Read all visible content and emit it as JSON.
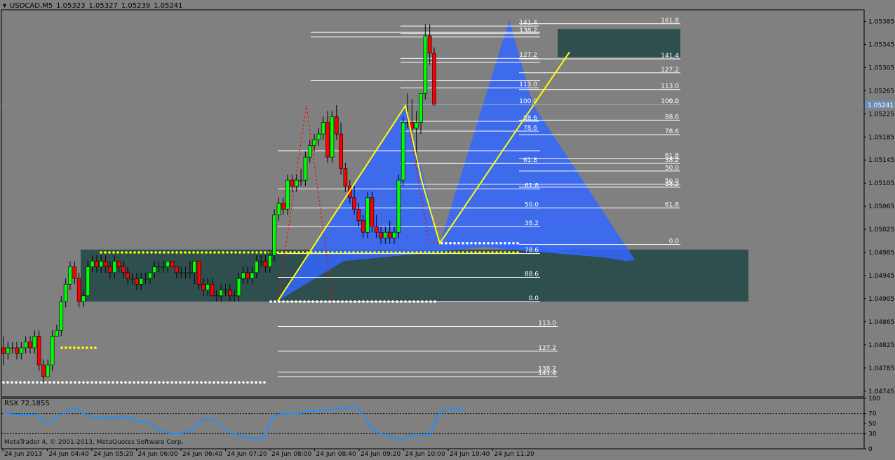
{
  "header": {
    "symbol": "USDCAD,M5",
    "open": "1.05323",
    "high": "1.05327",
    "low": "1.05239",
    "close": "1.05241"
  },
  "indicator": {
    "name": "RSX 72.1855",
    "levels": [
      "100",
      "70",
      "50",
      "30",
      "0"
    ]
  },
  "copyright": "MetaTrader 4, © 2001-2013, MetaQuotes Software Corp.",
  "colors": {
    "background": "#808080",
    "bull": "#00ff00",
    "bear": "#ff0000",
    "pattern": "#3366ff",
    "zone": "#2f4f4f",
    "trendline": "#ffff00",
    "rsx": "#1e90ff"
  },
  "price_label": "1.05241",
  "chart_data": {
    "type": "candlestick",
    "title": "USDCAD,M5",
    "ylim": [
      1.04735,
      1.05405
    ],
    "y_ticks": [
      "1.05385",
      "1.05345",
      "1.05305",
      "1.05265",
      "1.05225",
      "1.05185",
      "1.05145",
      "1.05105",
      "1.05065",
      "1.05025",
      "1.04985",
      "1.04945",
      "1.04905",
      "1.04865",
      "1.04825",
      "1.04785",
      "1.04745"
    ],
    "x_labels": [
      "24 Jun 2013",
      "24 Jun 04:40",
      "24 Jun 05:20",
      "24 Jun 06:00",
      "24 Jun 06:40",
      "24 Jun 07:20",
      "24 Jun 08:00",
      "24 Jun 08:40",
      "24 Jun 09:20",
      "24 Jun 10:00",
      "24 Jun 10:40",
      "24 Jun 11:20"
    ],
    "candles": [
      {
        "o": 1.0482,
        "h": 1.0484,
        "l": 1.0479,
        "c": 1.0481
      },
      {
        "o": 1.0481,
        "h": 1.0483,
        "l": 1.048,
        "c": 1.0482
      },
      {
        "o": 1.0482,
        "h": 1.0483,
        "l": 1.0481,
        "c": 1.0482
      },
      {
        "o": 1.0482,
        "h": 1.0483,
        "l": 1.048,
        "c": 1.0481
      },
      {
        "o": 1.0481,
        "h": 1.0483,
        "l": 1.048,
        "c": 1.0482
      },
      {
        "o": 1.0482,
        "h": 1.0484,
        "l": 1.0481,
        "c": 1.0483
      },
      {
        "o": 1.0483,
        "h": 1.0484,
        "l": 1.0481,
        "c": 1.0482
      },
      {
        "o": 1.0482,
        "h": 1.0485,
        "l": 1.0481,
        "c": 1.0484
      },
      {
        "o": 1.0484,
        "h": 1.0485,
        "l": 1.0478,
        "c": 1.0479
      },
      {
        "o": 1.0479,
        "h": 1.048,
        "l": 1.0476,
        "c": 1.0477
      },
      {
        "o": 1.0477,
        "h": 1.048,
        "l": 1.0477,
        "c": 1.0479
      },
      {
        "o": 1.0479,
        "h": 1.0485,
        "l": 1.0478,
        "c": 1.0484
      },
      {
        "o": 1.0484,
        "h": 1.0486,
        "l": 1.0484,
        "c": 1.0485
      },
      {
        "o": 1.0485,
        "h": 1.0491,
        "l": 1.0484,
        "c": 1.049
      },
      {
        "o": 1.049,
        "h": 1.0494,
        "l": 1.0489,
        "c": 1.0493
      },
      {
        "o": 1.0493,
        "h": 1.0497,
        "l": 1.0492,
        "c": 1.0496
      },
      {
        "o": 1.0496,
        "h": 1.0497,
        "l": 1.0493,
        "c": 1.0494
      },
      {
        "o": 1.0494,
        "h": 1.0495,
        "l": 1.0489,
        "c": 1.049
      },
      {
        "o": 1.049,
        "h": 1.0492,
        "l": 1.0489,
        "c": 1.0491
      },
      {
        "o": 1.0491,
        "h": 1.0497,
        "l": 1.0491,
        "c": 1.0496
      },
      {
        "o": 1.0496,
        "h": 1.0498,
        "l": 1.0495,
        "c": 1.0497
      },
      {
        "o": 1.0497,
        "h": 1.0498,
        "l": 1.0495,
        "c": 1.0496
      },
      {
        "o": 1.0496,
        "h": 1.0498,
        "l": 1.0495,
        "c": 1.0497
      },
      {
        "o": 1.0497,
        "h": 1.0498,
        "l": 1.0495,
        "c": 1.0496
      },
      {
        "o": 1.0496,
        "h": 1.0497,
        "l": 1.0494,
        "c": 1.0495
      },
      {
        "o": 1.0495,
        "h": 1.0498,
        "l": 1.0494,
        "c": 1.0497
      },
      {
        "o": 1.0497,
        "h": 1.0497,
        "l": 1.0495,
        "c": 1.0496
      },
      {
        "o": 1.0496,
        "h": 1.0497,
        "l": 1.0494,
        "c": 1.0495
      },
      {
        "o": 1.0495,
        "h": 1.0496,
        "l": 1.0493,
        "c": 1.0494
      },
      {
        "o": 1.0494,
        "h": 1.0495,
        "l": 1.0493,
        "c": 1.0494
      },
      {
        "o": 1.0494,
        "h": 1.0495,
        "l": 1.0492,
        "c": 1.0493
      },
      {
        "o": 1.0493,
        "h": 1.0495,
        "l": 1.0492,
        "c": 1.0494
      },
      {
        "o": 1.0494,
        "h": 1.0495,
        "l": 1.0493,
        "c": 1.0494
      },
      {
        "o": 1.0494,
        "h": 1.0495,
        "l": 1.0493,
        "c": 1.0495
      },
      {
        "o": 1.0495,
        "h": 1.0497,
        "l": 1.0494,
        "c": 1.0496
      },
      {
        "o": 1.0496,
        "h": 1.0497,
        "l": 1.0495,
        "c": 1.0496
      },
      {
        "o": 1.0496,
        "h": 1.0497,
        "l": 1.0495,
        "c": 1.0496
      },
      {
        "o": 1.0496,
        "h": 1.0497,
        "l": 1.0495,
        "c": 1.0497
      },
      {
        "o": 1.0497,
        "h": 1.0497,
        "l": 1.0496,
        "c": 1.0496
      },
      {
        "o": 1.0496,
        "h": 1.0496,
        "l": 1.0494,
        "c": 1.0495
      },
      {
        "o": 1.0495,
        "h": 1.0496,
        "l": 1.0494,
        "c": 1.0495
      },
      {
        "o": 1.0495,
        "h": 1.0496,
        "l": 1.0494,
        "c": 1.0495
      },
      {
        "o": 1.0495,
        "h": 1.0497,
        "l": 1.0494,
        "c": 1.0495
      },
      {
        "o": 1.0495,
        "h": 1.0497,
        "l": 1.0493,
        "c": 1.0497
      },
      {
        "o": 1.0497,
        "h": 1.0497,
        "l": 1.0492,
        "c": 1.0493
      },
      {
        "o": 1.0493,
        "h": 1.0494,
        "l": 1.0491,
        "c": 1.0492
      },
      {
        "o": 1.0492,
        "h": 1.0494,
        "l": 1.0491,
        "c": 1.0493
      },
      {
        "o": 1.0493,
        "h": 1.0494,
        "l": 1.0491,
        "c": 1.0491
      },
      {
        "o": 1.0491,
        "h": 1.0492,
        "l": 1.049,
        "c": 1.0491
      },
      {
        "o": 1.0491,
        "h": 1.0493,
        "l": 1.049,
        "c": 1.0492
      },
      {
        "o": 1.0492,
        "h": 1.0493,
        "l": 1.0491,
        "c": 1.0492
      },
      {
        "o": 1.0492,
        "h": 1.0493,
        "l": 1.049,
        "c": 1.0491
      },
      {
        "o": 1.0491,
        "h": 1.0492,
        "l": 1.049,
        "c": 1.0491
      },
      {
        "o": 1.0491,
        "h": 1.0495,
        "l": 1.049,
        "c": 1.0494
      },
      {
        "o": 1.0494,
        "h": 1.0496,
        "l": 1.0493,
        "c": 1.0495
      },
      {
        "o": 1.0495,
        "h": 1.0496,
        "l": 1.0493,
        "c": 1.0494
      },
      {
        "o": 1.0494,
        "h": 1.0496,
        "l": 1.0493,
        "c": 1.0495
      },
      {
        "o": 1.0495,
        "h": 1.0498,
        "l": 1.0494,
        "c": 1.0497
      },
      {
        "o": 1.0497,
        "h": 1.0498,
        "l": 1.0496,
        "c": 1.0497
      },
      {
        "o": 1.0497,
        "h": 1.0498,
        "l": 1.0495,
        "c": 1.0496
      },
      {
        "o": 1.0496,
        "h": 1.0499,
        "l": 1.0495,
        "c": 1.0498
      },
      {
        "o": 1.0498,
        "h": 1.0506,
        "l": 1.0497,
        "c": 1.0505
      },
      {
        "o": 1.0505,
        "h": 1.0508,
        "l": 1.0504,
        "c": 1.0507
      },
      {
        "o": 1.0507,
        "h": 1.0508,
        "l": 1.0505,
        "c": 1.0506
      },
      {
        "o": 1.0506,
        "h": 1.0512,
        "l": 1.0505,
        "c": 1.0511
      },
      {
        "o": 1.0511,
        "h": 1.0512,
        "l": 1.0509,
        "c": 1.051
      },
      {
        "o": 1.051,
        "h": 1.0512,
        "l": 1.0509,
        "c": 1.0511
      },
      {
        "o": 1.0511,
        "h": 1.0513,
        "l": 1.051,
        "c": 1.0511
      },
      {
        "o": 1.0511,
        "h": 1.0516,
        "l": 1.051,
        "c": 1.0515
      },
      {
        "o": 1.0515,
        "h": 1.0518,
        "l": 1.0514,
        "c": 1.0517
      },
      {
        "o": 1.0517,
        "h": 1.0519,
        "l": 1.0516,
        "c": 1.0518
      },
      {
        "o": 1.0518,
        "h": 1.052,
        "l": 1.0517,
        "c": 1.0519
      },
      {
        "o": 1.0519,
        "h": 1.0522,
        "l": 1.0518,
        "c": 1.0521
      },
      {
        "o": 1.0521,
        "h": 1.0523,
        "l": 1.0514,
        "c": 1.0515
      },
      {
        "o": 1.0515,
        "h": 1.0523,
        "l": 1.0514,
        "c": 1.0522
      },
      {
        "o": 1.0522,
        "h": 1.0524,
        "l": 1.0518,
        "c": 1.0519
      },
      {
        "o": 1.0519,
        "h": 1.0521,
        "l": 1.0512,
        "c": 1.0513
      },
      {
        "o": 1.0513,
        "h": 1.0514,
        "l": 1.0509,
        "c": 1.051
      },
      {
        "o": 1.051,
        "h": 1.0511,
        "l": 1.0507,
        "c": 1.0508
      },
      {
        "o": 1.0508,
        "h": 1.051,
        "l": 1.0505,
        "c": 1.0506
      },
      {
        "o": 1.0506,
        "h": 1.0507,
        "l": 1.0503,
        "c": 1.0504
      },
      {
        "o": 1.0504,
        "h": 1.0505,
        "l": 1.0501,
        "c": 1.0502
      },
      {
        "o": 1.0502,
        "h": 1.0509,
        "l": 1.0501,
        "c": 1.0508
      },
      {
        "o": 1.0508,
        "h": 1.0509,
        "l": 1.0502,
        "c": 1.0503
      },
      {
        "o": 1.0503,
        "h": 1.0505,
        "l": 1.0501,
        "c": 1.0502
      },
      {
        "o": 1.0502,
        "h": 1.0503,
        "l": 1.05,
        "c": 1.0501
      },
      {
        "o": 1.0501,
        "h": 1.0503,
        "l": 1.05,
        "c": 1.0502
      },
      {
        "o": 1.0502,
        "h": 1.0504,
        "l": 1.05,
        "c": 1.0501
      },
      {
        "o": 1.0501,
        "h": 1.0503,
        "l": 1.05,
        "c": 1.0502
      },
      {
        "o": 1.0502,
        "h": 1.0512,
        "l": 1.0501,
        "c": 1.0511
      },
      {
        "o": 1.0511,
        "h": 1.0522,
        "l": 1.051,
        "c": 1.0521
      },
      {
        "o": 1.0521,
        "h": 1.0526,
        "l": 1.052,
        "c": 1.0521
      },
      {
        "o": 1.0521,
        "h": 1.0525,
        "l": 1.0519,
        "c": 1.052
      },
      {
        "o": 1.052,
        "h": 1.0523,
        "l": 1.0514,
        "c": 1.0521
      },
      {
        "o": 1.0521,
        "h": 1.0526,
        "l": 1.0519,
        "c": 1.0526
      },
      {
        "o": 1.0526,
        "h": 1.0538,
        "l": 1.0525,
        "c": 1.0536
      },
      {
        "o": 1.0536,
        "h": 1.0538,
        "l": 1.0531,
        "c": 1.0533
      },
      {
        "o": 1.0533,
        "h": 1.0534,
        "l": 1.0524,
        "c": 1.0524
      }
    ],
    "rsx": [
      70,
      70,
      68,
      68,
      66,
      67,
      66,
      68,
      62,
      56,
      53,
      56,
      62,
      68,
      73,
      78,
      80,
      77,
      70,
      66,
      64,
      62,
      62,
      61,
      61,
      61,
      62,
      63,
      63,
      60,
      55,
      55,
      54,
      50,
      43,
      38,
      35,
      32,
      30,
      30,
      31,
      33,
      35,
      40,
      52,
      58,
      60,
      58,
      54,
      46,
      40,
      32,
      30,
      26,
      24,
      22,
      21,
      20,
      20,
      28,
      54,
      64,
      68,
      70,
      70,
      70,
      70,
      72,
      74,
      75,
      75,
      76,
      77,
      77,
      78,
      79,
      80,
      81,
      82,
      82,
      80,
      66,
      54,
      42,
      34,
      30,
      27,
      25,
      22,
      20,
      18,
      24,
      26,
      26,
      26,
      27,
      26,
      50,
      70,
      76,
      78,
      80,
      80,
      78,
      74
    ]
  }
}
